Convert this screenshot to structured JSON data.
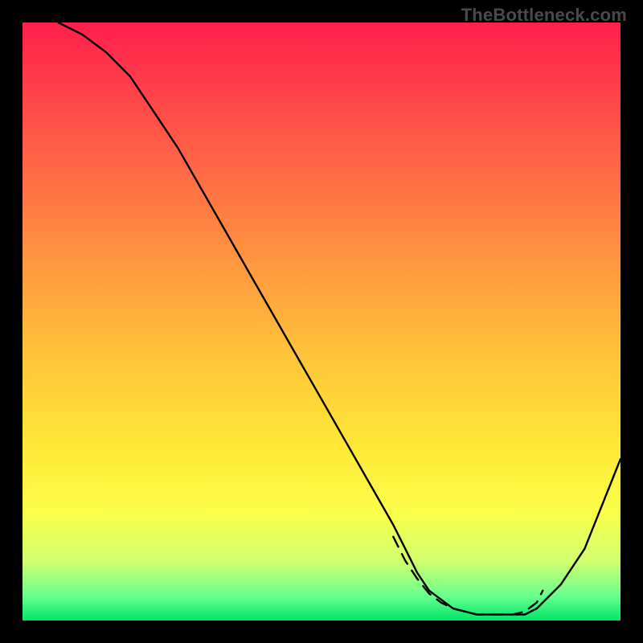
{
  "watermark": "TheBottleneck.com",
  "chart_data": {
    "type": "line",
    "title": "",
    "xlabel": "",
    "ylabel": "",
    "xlim": [
      0,
      100
    ],
    "ylim": [
      0,
      100
    ],
    "grid": false,
    "series": [
      {
        "name": "bottleneck-curve",
        "x": [
          6,
          10,
          14,
          18,
          22,
          26,
          30,
          34,
          38,
          42,
          46,
          50,
          54,
          58,
          62,
          64,
          66,
          68,
          72,
          76,
          80,
          84,
          86,
          90,
          94,
          100
        ],
        "y": [
          100,
          98,
          95,
          91,
          85,
          79,
          72,
          65,
          58,
          51,
          44,
          37,
          30,
          23,
          16,
          12,
          8,
          5,
          2,
          1,
          1,
          1,
          2,
          6,
          12,
          27
        ]
      }
    ],
    "annotations": [
      {
        "name": "trough-dashes",
        "style": "dashed-salmon",
        "x": [
          62,
          64,
          66,
          68,
          70,
          72,
          74,
          76,
          78,
          80,
          82,
          84,
          86,
          87
        ],
        "y": [
          14,
          10,
          7,
          4.5,
          3,
          2,
          1.5,
          1,
          1,
          1,
          1,
          1.5,
          3,
          5
        ]
      }
    ],
    "background_gradient": {
      "direction": "vertical",
      "stops": [
        {
          "pos": 0.0,
          "color": "#ff1f4b"
        },
        {
          "pos": 0.1,
          "color": "#ff3d4a"
        },
        {
          "pos": 0.25,
          "color": "#ff6a45"
        },
        {
          "pos": 0.4,
          "color": "#ff9640"
        },
        {
          "pos": 0.55,
          "color": "#ffc23a"
        },
        {
          "pos": 0.7,
          "color": "#ffe636"
        },
        {
          "pos": 0.82,
          "color": "#fbff4a"
        },
        {
          "pos": 0.9,
          "color": "#d2ff6f"
        },
        {
          "pos": 0.96,
          "color": "#66ff8e"
        },
        {
          "pos": 1.0,
          "color": "#00e56b"
        }
      ]
    }
  }
}
